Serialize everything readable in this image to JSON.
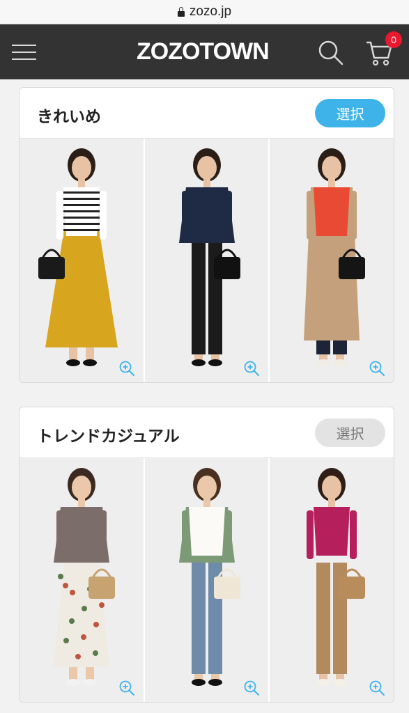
{
  "browser": {
    "url": "zozo.jp"
  },
  "header": {
    "logo": "ZOZOTOWN",
    "cart_count": "0"
  },
  "colors": {
    "header_bg": "#333333",
    "accent": "#3db3ea",
    "badge": "#e8192f"
  },
  "sections": [
    {
      "title": "きれいめ",
      "select_label": "選択",
      "selected": true,
      "outfits": [
        {
          "top": "#ffffff",
          "stripe": "#222222",
          "bottom": "#d8a51e",
          "bag": "#1a1a1a",
          "shoes": "#111111",
          "hair": "#2b1e16",
          "skin": "#e8c2a4"
        },
        {
          "top": "#1f2a44",
          "stripe": "#caa43a",
          "bottom": "#1b1b1b",
          "bag": "#111111",
          "shoes": "#111111",
          "hair": "#2b1e16",
          "skin": "#e8c2a4"
        },
        {
          "top": "#e94a34",
          "stripe": "#c8a784",
          "bottom": "#1d2438",
          "bag": "#151515",
          "shoes": "#f1ece4",
          "hair": "#2b1e16",
          "skin": "#e8c2a4"
        }
      ]
    },
    {
      "title": "トレンドカジュアル",
      "select_label": "選択",
      "selected": false,
      "outfits": [
        {
          "top": "#7a6d6a",
          "stripe": "#c84a4a",
          "bottom": "#efeae2",
          "bag": "#c7a372",
          "shoes": "#f2f2f2",
          "hair": "#3a2a20",
          "skin": "#ecc8ab"
        },
        {
          "top": "#7d9a77",
          "stripe": "#fbfaf6",
          "bottom": "#6e8caa",
          "bag": "#efe6d6",
          "shoes": "#111111",
          "hair": "#4a3020",
          "skin": "#ecc8ab"
        },
        {
          "top": "#b51f5c",
          "stripe": "#b51f5c",
          "bottom": "#b38a5e",
          "bag": "#b98c5b",
          "shoes": "#f4efe7",
          "hair": "#2e1e16",
          "skin": "#e8c2a4"
        }
      ]
    }
  ]
}
